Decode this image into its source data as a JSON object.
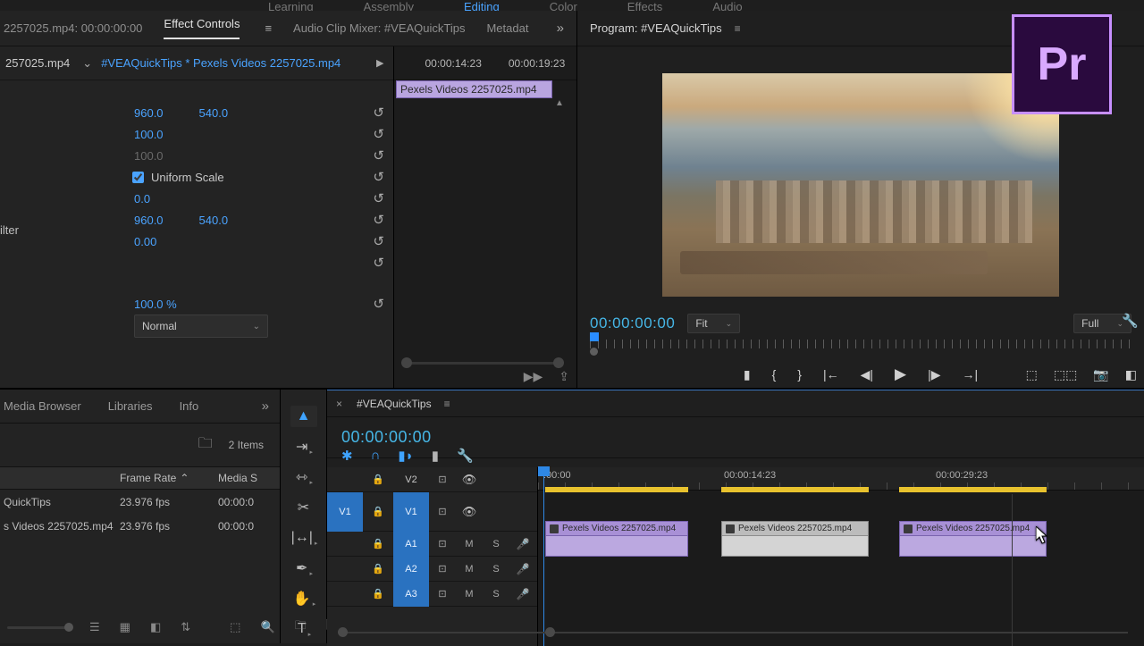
{
  "workspaces": [
    "Learning",
    "Assembly",
    "Editing",
    "Color",
    "Effects",
    "Audio"
  ],
  "workspace_active": 2,
  "source": {
    "tabs": {
      "title": "2257025.mp4: 00:00:00:00",
      "effect": "Effect Controls",
      "mixer": "Audio Clip Mixer: #VEAQuickTips",
      "meta": "Metadat"
    },
    "master": "257025.mp4",
    "sequence": "#VEAQuickTips * Pexels Videos 2257025.mp4",
    "rows": {
      "pos_x": "960.0",
      "pos_y": "540.0",
      "scale": "100.0",
      "scale_w": "100.0",
      "uniform": "Uniform Scale",
      "rot": "0.0",
      "anchor_x": "960.0",
      "anchor_y": "540.0",
      "flicker_label": "ilter",
      "flicker": "0.00",
      "opacity": "100.0 %",
      "blend": "Normal"
    },
    "mini": {
      "t1": "00:00:14:23",
      "t2": "00:00:19:23",
      "clip": "Pexels Videos 2257025.mp4"
    }
  },
  "program": {
    "title": "Program: #VEAQuickTips",
    "time": "00:00:00:00",
    "fit": "Fit",
    "res": "Full"
  },
  "project": {
    "tabs": [
      "Media Browser",
      "Libraries",
      "Info"
    ],
    "items_label": "2 Items",
    "cols": [
      "",
      "Frame Rate",
      "Media S"
    ],
    "rows": [
      {
        "name": "QuickTips",
        "fr": "23.976 fps",
        "ms": "00:00:0"
      },
      {
        "name": "s Videos 2257025.mp4",
        "fr": "23.976 fps",
        "ms": "00:00:0"
      }
    ]
  },
  "timeline": {
    "seqname": "#VEAQuickTips",
    "tc": "00:00:00:00",
    "marks": [
      ":00:00",
      "00:00:14:23",
      "00:00:29:23"
    ],
    "tracks": {
      "v2": "V2",
      "v1_src": "V1",
      "v1": "V1",
      "a1": "A1",
      "a2": "A2",
      "a3": "A3",
      "m": "M",
      "s": "S"
    },
    "clip": "Pexels Videos 2257025.mp4"
  },
  "logo": "Pr"
}
